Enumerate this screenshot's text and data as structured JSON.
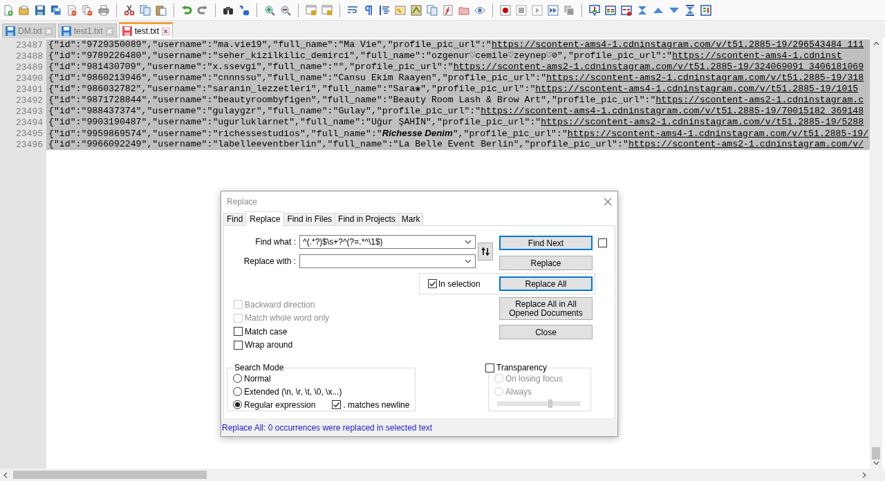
{
  "file_tabs": [
    {
      "label": "DM.txt",
      "selected": false,
      "modified": false
    },
    {
      "label": "test1.txt",
      "selected": false,
      "modified": false
    },
    {
      "label": "test.txt",
      "selected": true,
      "modified": true
    }
  ],
  "editor": {
    "lines": [
      {
        "number": "23487",
        "text": "{\"id\":\"9729350089\",\"username\":\"ma.vie19\",\"full_name\":\"Ma Vie\",\"profile_pic_url\":\"",
        "url": "https://scontent-ams4-1.cdninstagram.com/v/t51.2885-19/296543484_111",
        "selected": true
      },
      {
        "number": "23488",
        "text": "{\"id\":\"9789226480\",\"username\":\"seher_kizilkilic_demirci\",\"full_name\":\"ozgenur♡cemile♡zeynep♡⊘\",\"profile_pic_url\":\"",
        "url": "https://scontent-ams4-1.cdninst",
        "selected": true
      },
      {
        "number": "23489",
        "text": "{\"id\":\"981430709\",\"username\":\"x.ssevgi\",\"full_name\":\"\",\"profile_pic_url\":\"",
        "url": "https://scontent-ams2-1.cdninstagram.com/v/t51.2885-19/324069091_3406181069",
        "selected": true
      },
      {
        "number": "23490",
        "text": "{\"id\":\"9860213946\",\"username\":\"cnnnssu\",\"full_name\":\"Cansu Ekim Raayen\",\"profile_pic_url\":\"",
        "url": "https://scontent-ams2-1.cdninstagram.com/v/t51.2885-19/318",
        "selected": true
      },
      {
        "number": "23491",
        "text": "{\"id\":\"986032782\",\"username\":\"saranin_lezzetleri\",\"full_name\":\"Sara❀\",\"profile_pic_url\":\"",
        "url": "https://scontent-ams4-1.cdninstagram.com/v/t51.2885-19/1015",
        "selected": true
      },
      {
        "number": "23492",
        "text": "{\"id\":\"9871728844\",\"username\":\"beautyroombyfigen\",\"full_name\":\"Beauty Room Lash & Brow Art\",\"profile_pic_url\":\"",
        "url": "https://scontent-ams2-1.cdninstagram.c",
        "selected": true
      },
      {
        "number": "23493",
        "text": "{\"id\":\"988437374\",\"username\":\"gulaygzr\",\"full_name\":\"Gulay\",\"profile_pic_url\":\"",
        "url": "https://scontent-ams4-1.cdninstagram.com/v/t51.2885-19/70015182_369148",
        "selected": true
      },
      {
        "number": "23494",
        "text": "{\"id\":\"9903190487\",\"username\":\"ugurluklarnet\",\"full_name\":\"Uğur ŞAHİN\",\"profile_pic_url\":\"",
        "url": "https://scontent-ams2-1.cdninstagram.com/v/t51.2885-19/5288",
        "selected": true
      },
      {
        "number": "23495",
        "text": "{\"id\":\"9959869574\",\"username\":\"richessestudios\",\"full_name\":\"**Richesse Denim**\",\"profile_pic_url\":\"",
        "url": "https://scontent-ams4-1.cdninstagram.com/v/t51.2885-19/",
        "selected": true
      },
      {
        "number": "23496",
        "text": "{\"id\":\"9966092249\",\"username\":\"labelleeventberlin\",\"full_name\":\"La Belle Event Berlin\",\"profile_pic_url\":\"",
        "url": "https://scontent-ams2-1.cdninstagram.com/v/",
        "selected": true
      }
    ]
  },
  "dialog": {
    "title": "Replace",
    "tabs": [
      {
        "label": "Find",
        "selected": false
      },
      {
        "label": "Replace",
        "selected": true
      },
      {
        "label": "Find in Files",
        "selected": false
      },
      {
        "label": "Find in Projects",
        "selected": false
      },
      {
        "label": "Mark",
        "selected": false
      }
    ],
    "fields": [
      {
        "label": "Find what :",
        "value": "^(.*?)$\\s+?^(?=.*^\\1$)"
      },
      {
        "label": "Replace with :"
      }
    ],
    "buttons": [
      {
        "label": "Find Next",
        "focused": true
      },
      {
        "label": "Replace",
        "focused": false
      },
      {
        "label": "Replace All",
        "focused": true
      },
      {
        "label": "Replace All in All Opened Documents",
        "focused": false
      },
      {
        "label": "Close",
        "focused": false
      }
    ],
    "side_checkbox": {
      "checked": false
    },
    "in_selection": {
      "label": "In selection",
      "checked": true
    },
    "options": [
      {
        "label": "Backward direction",
        "checked": false,
        "disabled": true
      },
      {
        "label": "Match whole word only",
        "checked": false,
        "disabled": true
      },
      {
        "label": "Match case",
        "checked": false,
        "disabled": false
      },
      {
        "label": "Wrap around",
        "checked": false,
        "disabled": false
      }
    ],
    "search_mode": {
      "title": "Search Mode",
      "modes": [
        {
          "label": "Normal",
          "selected": false
        },
        {
          "label": "Extended (\\n, \\r, \\t, \\0, \\x...)",
          "selected": false
        },
        {
          "label": "Regular expression",
          "selected": true
        }
      ],
      "dot_newline": {
        "label": ". matches newline",
        "checked": true
      }
    },
    "transparency": {
      "label": "Transparency",
      "checked": false,
      "modes": [
        {
          "label": "On losing focus",
          "selected": false,
          "disabled": true
        },
        {
          "label": "Always",
          "selected": false,
          "disabled": true
        }
      ],
      "slider": {
        "level": 0.64,
        "disabled": true
      }
    },
    "status": "Replace All: 0 occurrences were replaced in selected text"
  }
}
